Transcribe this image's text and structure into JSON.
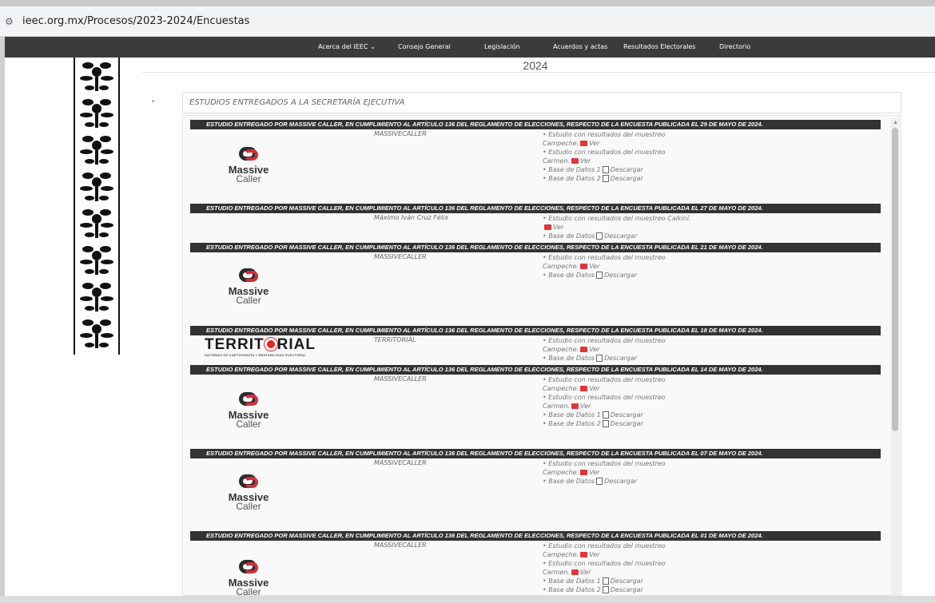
{
  "browser": {
    "url": "ieec.org.mx/Procesos/2023-2024/Encuestas",
    "site_info_icon": "tune-icon"
  },
  "nav": {
    "items": [
      "Acerca del IEEC ⌄",
      "Consejo General",
      "Legislación",
      "Acuerdos y actas",
      "Resultados Electorales",
      "Directorio"
    ]
  },
  "page": {
    "year": "2024",
    "section_title": "ESTUDIOS ENTREGADOS A LA SECRETARÍA EJECUTIVA",
    "bullet": "•"
  },
  "studies": [
    {
      "header": "ESTUDIO ENTREGADO POR MASSIVE CALLER, EN CUMPLIMIENTO AL ARTÍCULO 136 DEL REGLAMENTO DE ELECCIONES, RESPECTO DE LA ENCUESTA PUBLICADA EL 29 DE MAYO DE 2024.",
      "provider": "MASSIVECALLER",
      "logo": "massive-caller",
      "lines": [
        {
          "text": "• Estudio con resultados del muestreo"
        },
        {
          "text": "Campeche.",
          "icon": "pdf",
          "link": "Ver"
        },
        {
          "text": "• Estudio con resultados del muestreo"
        },
        {
          "text": "Carmen.",
          "icon": "pdf",
          "link": "Ver"
        },
        {
          "text": "• Base de Datos 1",
          "icon": "doc",
          "link": "Descargar"
        },
        {
          "text": "• Base de Datos 2",
          "icon": "doc",
          "link": "Descargar"
        }
      ]
    },
    {
      "header": "ESTUDIO ENTREGADO POR MASSIVE CALLER, EN CUMPLIMIENTO AL ARTÍCULO 136 DEL REGLAMENTO DE ELECCIONES, RESPECTO DE LA ENCUESTA PUBLICADA EL 27 DE MAYO DE 2024.",
      "provider": "Máximo Iván Cruz Félix",
      "logo": "",
      "lines": [
        {
          "text": "• Estudio con resultados del muestreo Calkiní."
        },
        {
          "text": "",
          "icon": "pdf",
          "link": "Ver"
        },
        {
          "text": "• Base de Datos",
          "icon": "doc",
          "link": "Descargar"
        }
      ]
    },
    {
      "header": "ESTUDIO ENTREGADO POR MASSIVE CALLER, EN CUMPLIMIENTO AL ARTÍCULO 136 DEL REGLAMENTO DE ELECCIONES, RESPECTO DE LA ENCUESTA PUBLICADA EL 21 DE MAYO DE 2024.",
      "provider": "MASSIVECALLER",
      "logo": "massive-caller",
      "lines": [
        {
          "text": "• Estudio con resultados del muestreo"
        },
        {
          "text": "Campeche.",
          "icon": "pdf",
          "link": "Ver"
        },
        {
          "text": "• Base de Datos",
          "icon": "doc",
          "link": "Descargar"
        }
      ]
    },
    {
      "header": "ESTUDIO ENTREGADO POR MASSIVE CALLER, EN CUMPLIMIENTO AL ARTÍCULO 136 DEL REGLAMENTO DE ELECCIONES, RESPECTO DE LA ENCUESTA PUBLICADA EL 18 DE MAYO DE 2024.",
      "provider": "TERRITORIAL",
      "logo": "territorial",
      "lines": [
        {
          "text": "• Estudio con resultados del muestreo"
        },
        {
          "text": "Campeche.",
          "icon": "pdf",
          "link": "Ver"
        },
        {
          "text": "• Base de Datos",
          "icon": "doc",
          "link": "Descargar"
        }
      ]
    },
    {
      "header": "ESTUDIO ENTREGADO POR MASSIVE CALLER, EN CUMPLIMIENTO AL ARTÍCULO 136 DEL REGLAMENTO DE ELECCIONES, RESPECTO DE LA ENCUESTA PUBLICADA EL 14 DE MAYO DE 2024.",
      "provider": "MASSIVECALLER",
      "logo": "massive-caller",
      "lines": [
        {
          "text": "• Estudio con resultados del muestreo"
        },
        {
          "text": "Campeche.",
          "icon": "pdf",
          "link": "Ver"
        },
        {
          "text": "• Estudio con resultados del muestreo"
        },
        {
          "text": "Carmen.",
          "icon": "pdf",
          "link": "Ver"
        },
        {
          "text": "• Base de Datos 1",
          "icon": "doc",
          "link": "Descargar"
        },
        {
          "text": "• Base de Datos 2",
          "icon": "doc",
          "link": "Descargar"
        }
      ]
    },
    {
      "header": "ESTUDIO ENTREGADO POR MASSIVE CALLER, EN CUMPLIMIENTO AL ARTÍCULO 136 DEL REGLAMENTO DE ELECCIONES, RESPECTO DE LA ENCUESTA PUBLICADA EL 07 DE MAYO DE 2024.",
      "provider": "MASSIVECALLER",
      "logo": "massive-caller",
      "lines": [
        {
          "text": "• Estudio con resultados del muestreo"
        },
        {
          "text": "Campeche.",
          "icon": "pdf",
          "link": "Ver"
        },
        {
          "text": "• Base de Datos",
          "icon": "doc",
          "link": "Descargar"
        }
      ]
    },
    {
      "header": "ESTUDIO ENTREGADO POR MASSIVE CALLER, EN CUMPLIMIENTO AL ARTÍCULO 136 DEL REGLAMENTO DE ELECCIONES, RESPECTO DE LA ENCUESTA PUBLICADA EL 01 DE MAYO DE 2024.",
      "provider": "MASSIVECALLER",
      "logo": "massive-caller",
      "lines": [
        {
          "text": "• Estudio con resultados del muestreo"
        },
        {
          "text": "Campeche.",
          "icon": "pdf",
          "link": "Ver"
        },
        {
          "text": "• Estudio con resultados del muestreo"
        },
        {
          "text": "Carmen.",
          "icon": "pdf",
          "link": "Ver"
        },
        {
          "text": "• Base de Datos 1",
          "icon": "doc",
          "link": "Descargar"
        },
        {
          "text": "• Base de Datos 2",
          "icon": "doc",
          "link": "Descargar"
        }
      ]
    }
  ],
  "logos": {
    "massive_caller": {
      "line1": "Massive",
      "line2": "Caller"
    },
    "territorial": {
      "word_a": "TERRIT",
      "word_b": "RIAL",
      "tagline": "SISTEMAS DE CARTOGRAFÍA Y RENTABILIDAD ELECTORAL"
    }
  },
  "colors": {
    "nav_bg": "#3b3b3b",
    "header_bg": "#333333",
    "pdf_red": "#e2353b",
    "logo_red": "#d32f3a"
  }
}
